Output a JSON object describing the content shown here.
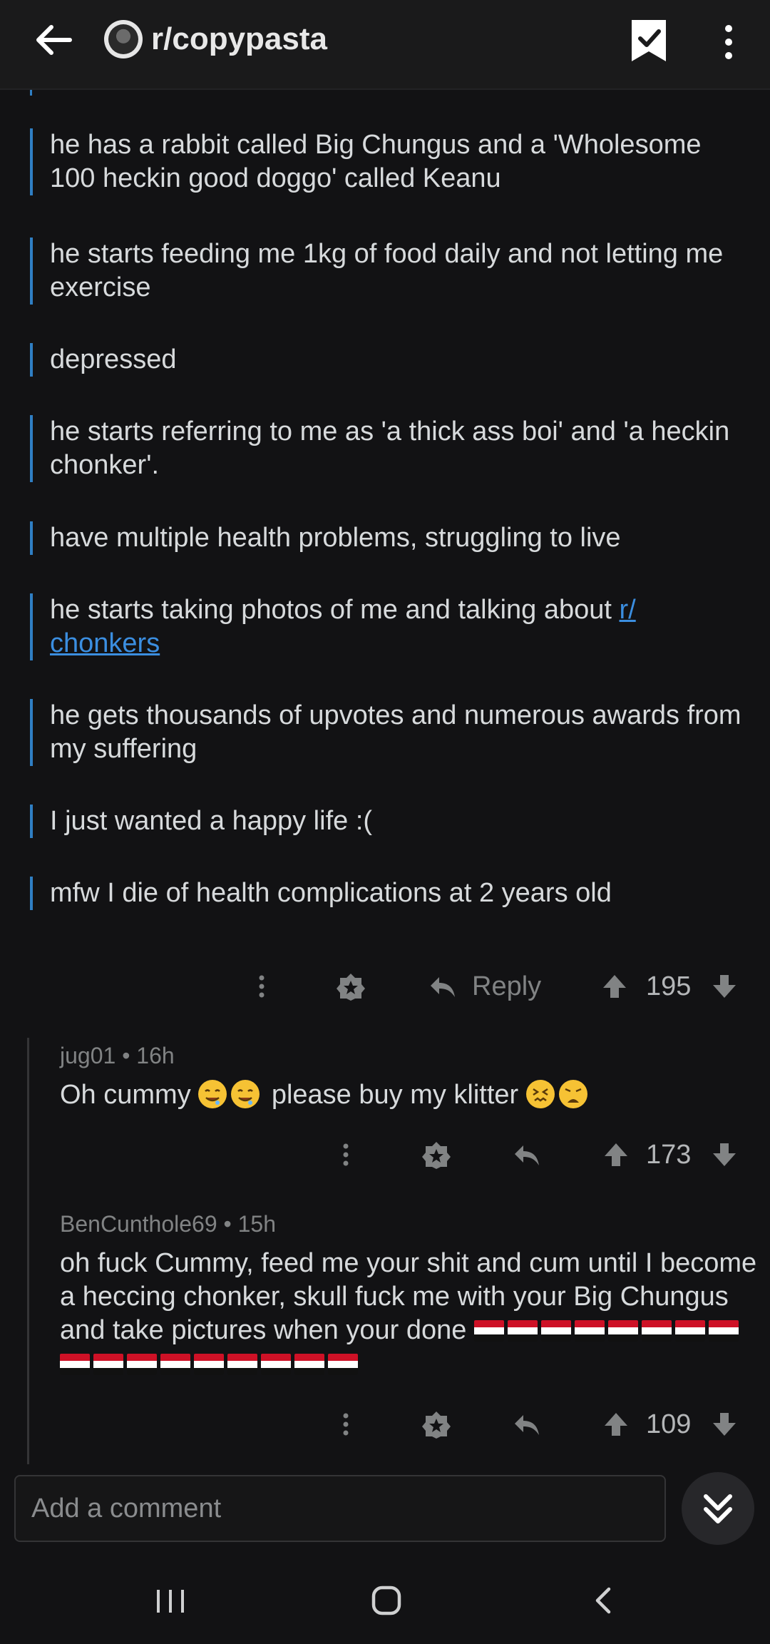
{
  "header": {
    "subreddit": "r/copypasta"
  },
  "quotes": [
    "he has a rabbit called Big Chungus and a 'Wholesome 100 heckin good doggo' called Keanu",
    "he starts feeding me 1kg of food daily and not letting me exercise",
    "depressed",
    "he starts referring to me as 'a thick ass boi' and 'a heckin chonker'.",
    "have multiple health problems, struggling to live",
    "he starts taking photos of me and talking about",
    "he gets thousands of upvotes and numerous awards from my suffering",
    "I just wanted a happy life :(",
    "mfw I die of health complications at 2 years old"
  ],
  "quote_link": "r/ chonkers",
  "post_actions": {
    "reply_label": "Reply",
    "score": "195"
  },
  "comments": [
    {
      "author": "jug01",
      "age": "16h",
      "text_a": "Oh cummy",
      "text_b": "please buy my klitter",
      "emoji_a": [
        "drooling-face",
        "drooling-face"
      ],
      "emoji_b": [
        "confounded-face",
        "weary-face"
      ],
      "score": "173"
    },
    {
      "author": "BenCunthole69",
      "age": "15h",
      "text": "oh fuck Cummy, feed me your shit and cum until I become a heccing chonker, skull fuck me with your Big Chungus and take pictures when your done",
      "flag_icon": "iraq-flag",
      "flag_count": 17,
      "score": "109"
    }
  ],
  "composer": {
    "placeholder": "Add a comment"
  },
  "colors": {
    "background": "#121214",
    "quote_bar": "#2f7fc4",
    "link": "#3b8ee0",
    "muted": "#818384"
  }
}
